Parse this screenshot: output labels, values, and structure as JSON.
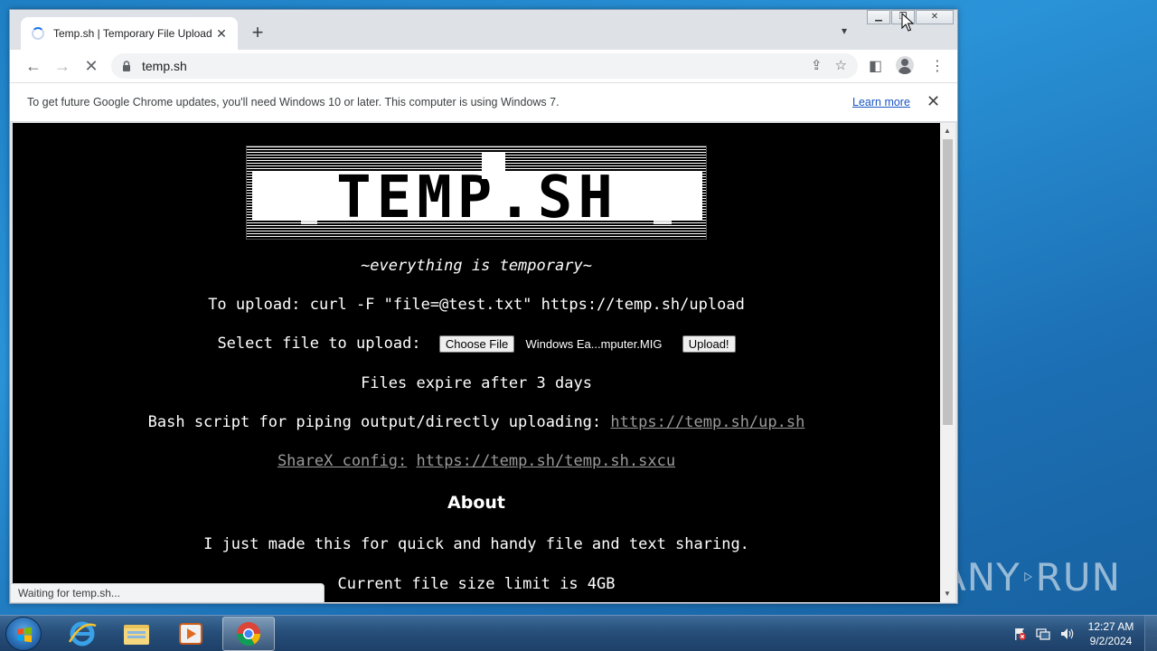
{
  "browser": {
    "tab_title": "Temp.sh | Temporary File Upload",
    "url": "temp.sh",
    "infobar_text": "To get future Google Chrome updates, you'll need Windows 10 or later. This computer is using Windows 7.",
    "infobar_link": "Learn more",
    "status_text": "Waiting for temp.sh..."
  },
  "page": {
    "tagline": "~everything is temporary~",
    "upload_cmd": "To upload: curl -F \"file=@test.txt\" https://temp.sh/upload",
    "select_label": "Select file to upload:",
    "choose_file_label": "Choose File",
    "chosen_file_name": "Windows Ea...mputer.MIG",
    "upload_button_label": "Upload!",
    "expire_text": "Files expire after 3 days",
    "bash_label": "Bash script for piping output/directly uploading:",
    "bash_link": "https://temp.sh/up.sh",
    "sharex_label": "ShareX config:",
    "sharex_link": "https://temp.sh/temp.sh.sxcu",
    "about_heading": "About",
    "about_text": "I just made this for quick and handy file and text sharing.",
    "size_limit": "Current file size limit is 4GB",
    "logo_text": "TEMP.SH"
  },
  "taskbar": {
    "time": "12:27 AM",
    "date": "9/2/2024",
    "watermark": "ANY RUN"
  },
  "colors": {
    "page_bg": "#000000",
    "link_gray": "#9a9a9a",
    "chrome_link": "#1a56c4"
  }
}
